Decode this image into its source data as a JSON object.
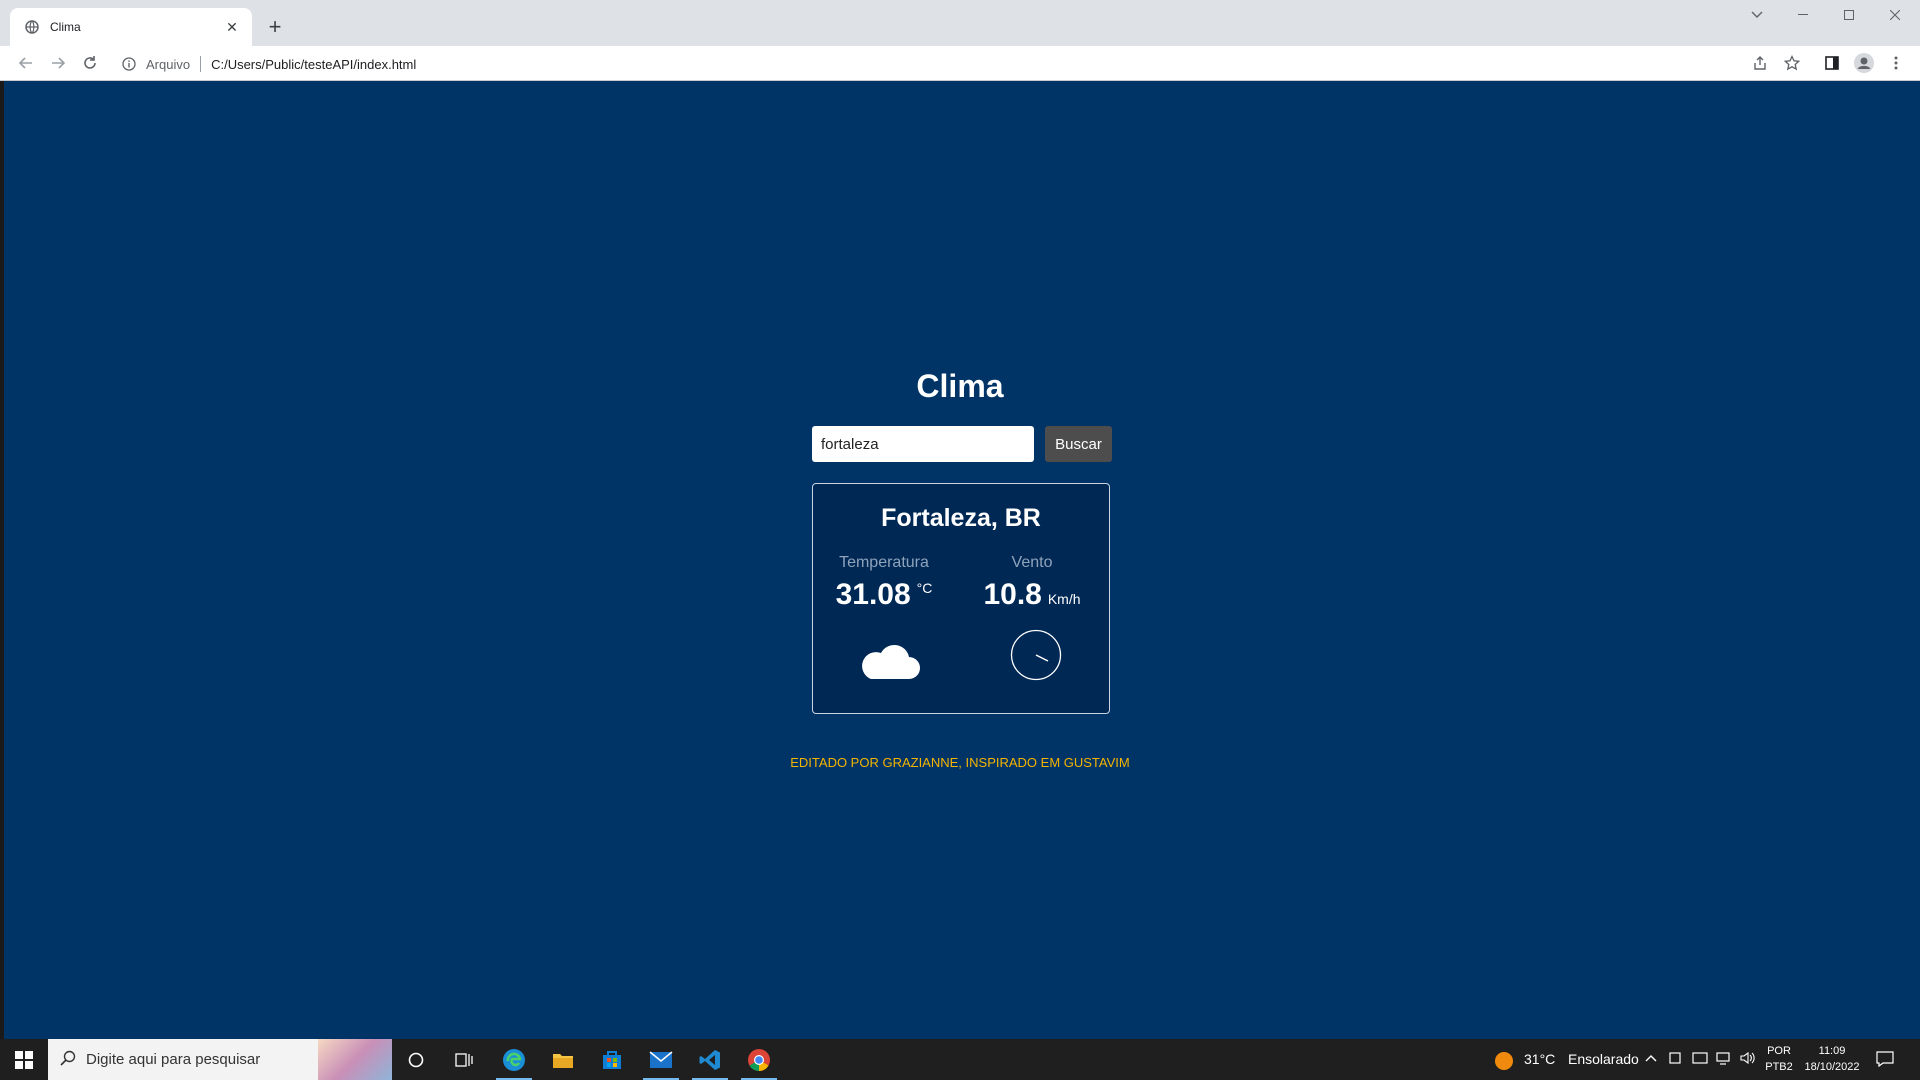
{
  "browser": {
    "tab_title": "Clima",
    "address_scheme": "Arquivo",
    "address_url": "C:/Users/Public/testeAPI/index.html"
  },
  "app": {
    "title": "Clima",
    "search": {
      "value": "fortaleza",
      "button_label": "Buscar"
    },
    "weather": {
      "city": "Fortaleza, BR",
      "temperature_label": "Temperatura",
      "temperature_value": "31.08",
      "temperature_unit": "°C",
      "wind_label": "Vento",
      "wind_value": "10.8",
      "wind_unit": "Km/h",
      "weather_icon": "cloud-icon",
      "wind_icon": "wind-compass-icon"
    },
    "credit": "EDITADO POR GRAZIANNE, INSPIRADO EM GUSTAVIM"
  },
  "taskbar": {
    "search_placeholder": "Digite aqui para pesquisar",
    "weather_temp": "31°C",
    "weather_desc": "Ensolarado",
    "lang_top": "POR",
    "lang_bottom": "PTB2",
    "time": "11:09",
    "date": "18/10/2022"
  },
  "colors": {
    "page_bg": "#003366",
    "card_bg": "#002855",
    "credit": "#f4b400",
    "button_bg": "#4d4d4d"
  }
}
